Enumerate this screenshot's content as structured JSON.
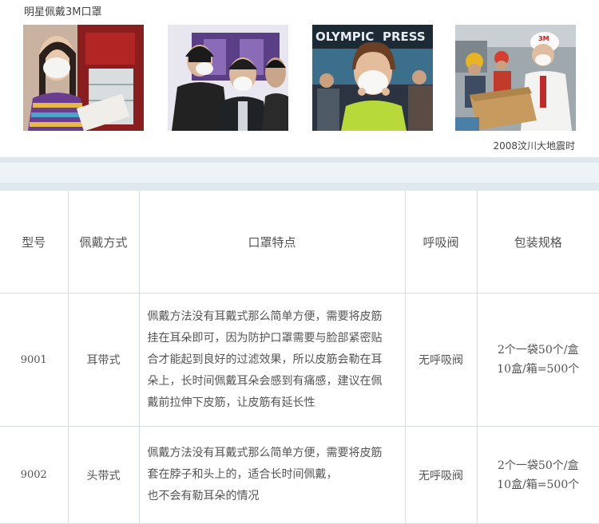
{
  "captions": {
    "top": "明星佩戴3M口罩",
    "bottom": "2008汶川大地震时"
  },
  "photos": {
    "sign_text_olympic": "OLYMPIC",
    "sign_text_express": "PRESS",
    "helmet_logo": "3M"
  },
  "table": {
    "headers": {
      "model": "型号",
      "wearing": "佩戴方式",
      "features": "口罩特点",
      "valve": "呼吸阀",
      "packaging": "包装规格"
    },
    "rows": [
      {
        "model": "9001",
        "wearing": "耳带式",
        "features": [
          "佩戴方法没有耳戴式那么简单方便，需要将皮筋",
          "挂在耳朵即可，因为防护口罩需要与脸部紧密贴",
          "合才能起到良好的过滤效果，所以皮筋会勒在耳",
          "朵上，长时间佩戴耳朵会感到有痛感，建议在佩",
          "戴前拉伸下皮筋，让皮筋有延长性"
        ],
        "valve": "无呼吸阀",
        "packaging": [
          "2个一袋50个/盒",
          "10盒/箱=500个"
        ]
      },
      {
        "model": "9002",
        "wearing": "头带式",
        "features": [
          "佩戴方法没有耳戴式那么简单方便，需要将皮筋",
          "套在脖子和头上的，适合长时间佩戴，",
          "也不会有勒耳朵的情况"
        ],
        "valve": "无呼吸阀",
        "packaging": [
          "2个一袋50个/盒",
          "10盒/箱=500个"
        ]
      }
    ]
  }
}
